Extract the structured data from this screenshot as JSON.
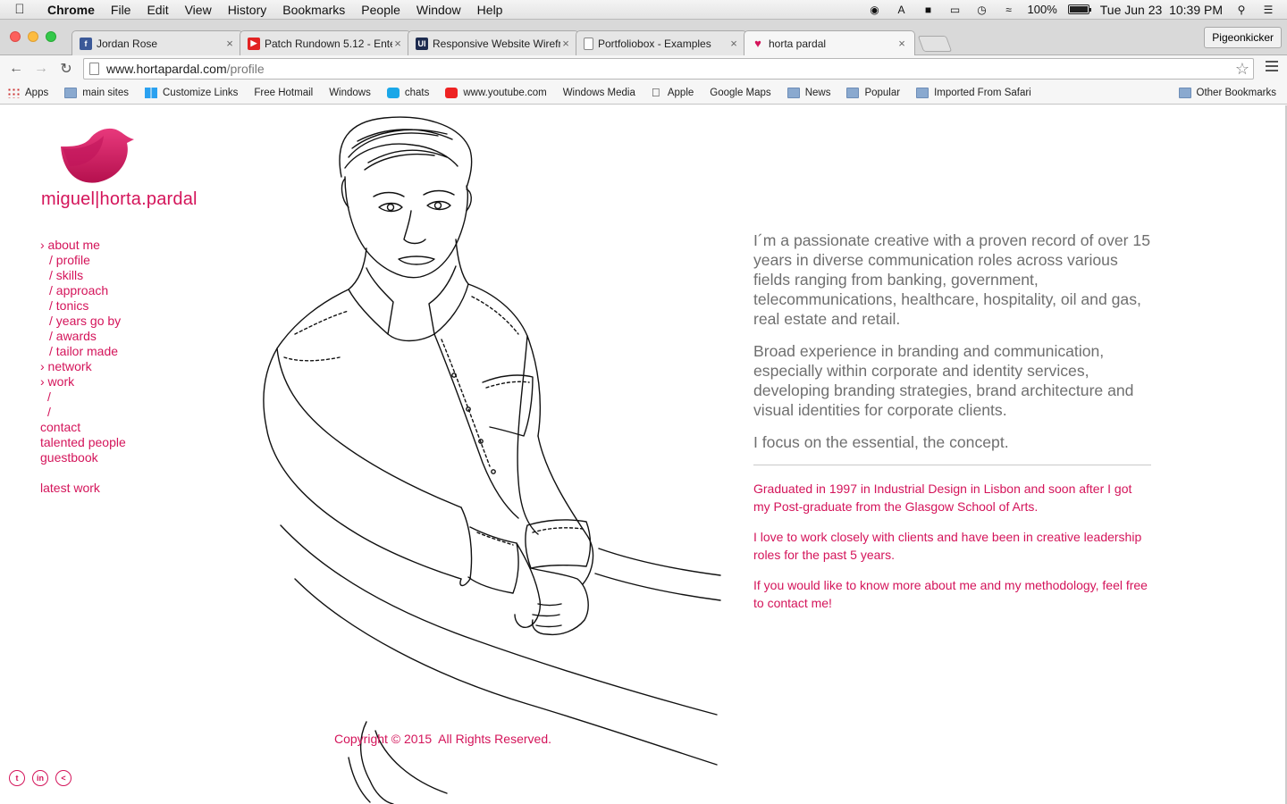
{
  "menubar": {
    "apple": "",
    "items": [
      "Chrome",
      "File",
      "Edit",
      "View",
      "History",
      "Bookmarks",
      "People",
      "Window",
      "Help"
    ],
    "battery_percent": "100%",
    "battery_level": 1.0,
    "datetime": "Tue Jun 23  10:39 PM"
  },
  "tabs": [
    {
      "title": "Jordan Rose",
      "icon": "facebook-icon",
      "color": "#3b5998",
      "glyph": "f"
    },
    {
      "title": "Patch Rundown 5.12 - Ente",
      "icon": "youtube-icon",
      "color": "#e22222",
      "glyph": "▶"
    },
    {
      "title": "Responsive Website Wirefr",
      "icon": "ui-icon",
      "color": "#1d2b4f",
      "glyph": "UI"
    },
    {
      "title": "Portfoliobox - Examples",
      "icon": "page-icon",
      "color": "#ffffff",
      "glyph": ""
    },
    {
      "title": "horta pardal",
      "icon": "bird-icon",
      "color": "#d4145a",
      "glyph": "♥"
    }
  ],
  "profile_button": "Pigeonkicker",
  "address": {
    "host": "www.hortapardal.com",
    "path": "/profile"
  },
  "bookmarks": [
    {
      "label": "Apps",
      "icon": "grid"
    },
    {
      "label": "main sites",
      "icon": "folder"
    },
    {
      "label": "Customize Links",
      "icon": "win"
    },
    {
      "label": "Free Hotmail",
      "icon": "page"
    },
    {
      "label": "Windows",
      "icon": "page"
    },
    {
      "label": "chats",
      "icon": "chat"
    },
    {
      "label": "www.youtube.com",
      "icon": "yt"
    },
    {
      "label": "Windows Media",
      "icon": "page"
    },
    {
      "label": "Apple",
      "icon": "apple"
    },
    {
      "label": "Google Maps",
      "icon": "page"
    },
    {
      "label": "News",
      "icon": "folder"
    },
    {
      "label": "Popular",
      "icon": "folder"
    },
    {
      "label": "Imported From Safari",
      "icon": "folder"
    }
  ],
  "other_bookmarks": "Other Bookmarks",
  "site": {
    "brand": {
      "first": "miguel",
      "second": "horta",
      "dot": ".",
      "third": "pardal"
    },
    "brand_color": "#d4145a",
    "nav": {
      "about": "› about me",
      "profile": "/ profile",
      "skills": "/ skills",
      "approach": "/ approach",
      "tonics": "/ tonics",
      "years": "/ years go by",
      "awards": "/ awards",
      "tailor": "/ tailor made",
      "network": "› network",
      "work": "› work",
      "work_sub1": "/",
      "work_sub2": "/",
      "contact": "contact",
      "talented": "talented people",
      "guestbook": "guestbook",
      "latest": "latest work"
    },
    "bio": {
      "p1": "I´m a passionate creative with a proven record of over 15 years in diverse communication roles across various fields ranging from banking, government, telecommunications, healthcare, hospitality, oil and gas, real estate and retail.",
      "p2": "Broad experience in branding and communication, especially within corporate and identity services, developing branding strategies, brand architecture and visual identities for corporate clients.",
      "p3": "I focus on the essential, the concept.",
      "d1": "Graduated in 1997 in Industrial Design in Lisbon and soon after I got my Post-graduate from the Glasgow School of Arts.",
      "d2": "I love to work closely with clients and have been in creative leadership roles for the past 5 years.",
      "d3": "If you would like to know more about me and my methodology, feel free to contact me!"
    },
    "copyright": "Copyright © 2015  All Rights Reserved.",
    "social": [
      {
        "name": "twitter-icon",
        "glyph": "t"
      },
      {
        "name": "linkedin-icon",
        "glyph": "in"
      },
      {
        "name": "share-icon",
        "glyph": "<"
      }
    ]
  }
}
